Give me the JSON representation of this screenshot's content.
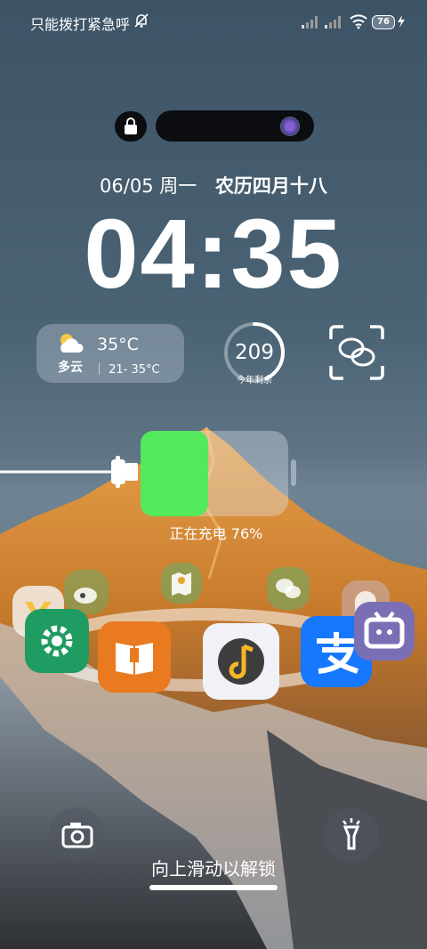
{
  "status_bar": {
    "carrier": "只能拨打紧急呼",
    "battery_level": "76",
    "icons": [
      "bell-off-icon",
      "signal-icon",
      "signal-icon",
      "wifi-icon",
      "battery-icon",
      "charging-bolt-icon"
    ]
  },
  "lock": {
    "date": "06/05 周一",
    "lunar_date": "农历四月十八",
    "time": "04:35"
  },
  "weather": {
    "temperature": "35°C",
    "condition": "多云",
    "range": "21- 35°C",
    "icon": "partly-cloudy-icon"
  },
  "days_left": {
    "value": "209",
    "label": "今年剩余",
    "fraction_elapsed": 0.43
  },
  "charging": {
    "text": "正在充电  76%",
    "level": 0.76,
    "fill_color": "#54e85b"
  },
  "apps": [
    {
      "name": "weibo-app-icon",
      "color": "#e74c3c"
    },
    {
      "name": "maps-app-icon",
      "color": "#f1c40f"
    },
    {
      "name": "wechat-app-icon",
      "color": "#3fb34f"
    },
    {
      "name": "ghost-app-icon",
      "color": "#ffffff"
    },
    {
      "name": "pinned-app-icon",
      "color": "#f5c23c"
    },
    {
      "name": "settings-app-icon",
      "color": "#1faa6b"
    },
    {
      "name": "books-app-icon",
      "color": "#f08a1f"
    },
    {
      "name": "music-app-icon",
      "color": "#2f2f2f"
    },
    {
      "name": "alipay-app-icon",
      "color": "#1677ff"
    },
    {
      "name": "bilibili-app-icon",
      "color": "#7a6fb5"
    }
  ],
  "bottom": {
    "unlock_hint": "向上滑动以解锁",
    "left_icon": "camera-icon",
    "right_icon": "flashlight-icon"
  }
}
